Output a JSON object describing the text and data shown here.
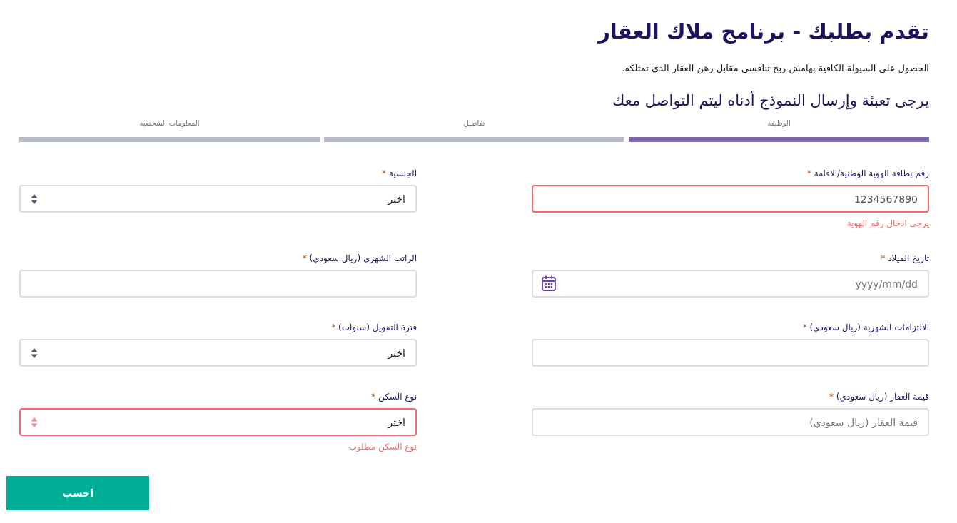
{
  "title": "تقدم بطلبك - برنامج ملاك العقار",
  "subtitle": "الحصول على السيولة الكافية بهامش ربح تنافسي مقابل رهن العقار الذي تمتلكه.",
  "instruction": "يرجى تعبئة وإرسال النموذج أدناه ليتم التواصل معك",
  "steps": [
    {
      "label": "الوظيفة",
      "selected": true
    },
    {
      "label": "تفاصيل",
      "selected": false
    },
    {
      "label": "المعلومات الشخصية",
      "selected": false
    }
  ],
  "fields": [
    {
      "kind": "text",
      "label": "رقم بطاقة الهوية الوطنية/الاقامة",
      "required_mark": "*",
      "value": "1234567890",
      "error": true,
      "error_text": "يرجى ادخال رقم الهوية"
    },
    {
      "kind": "select",
      "label": "الجنسية",
      "required_mark": "*",
      "value": "اختر",
      "error": false
    },
    {
      "kind": "date",
      "label": "تاريخ الميلاد",
      "required_mark": "*",
      "placeholder": "yyyy/mm/dd",
      "error": false
    },
    {
      "kind": "text",
      "label": "الراتب الشهري (ريال سعودي)",
      "required_mark": "*",
      "error": false
    },
    {
      "kind": "text",
      "label": "الالتزامات الشهرية (ريال سعودي)",
      "required_mark": "*",
      "error": false
    },
    {
      "kind": "select",
      "label": "فترة التمويل (سنوات)",
      "required_mark": "*",
      "value": "اختر",
      "error": false
    },
    {
      "kind": "text",
      "label": "قيمة العقار (ريال سعودي)",
      "required_mark": "*",
      "placeholder": "قيمة العقار (ريال سعودي)",
      "error": false
    },
    {
      "kind": "select",
      "label": "نوع السكن",
      "required_mark": "*",
      "value": "اختر",
      "error": true,
      "error_text": "نوع السكن مطلوب"
    }
  ],
  "submit": "احسب"
}
